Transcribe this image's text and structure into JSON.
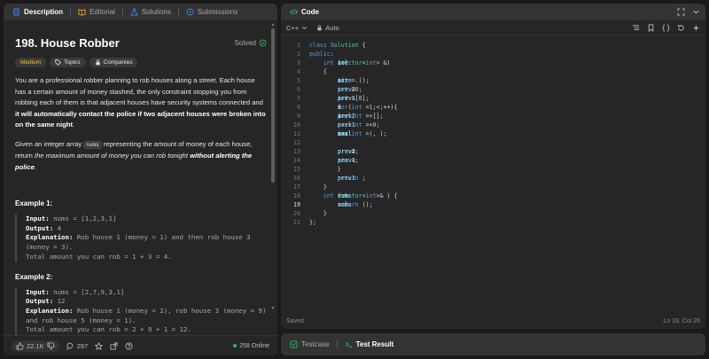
{
  "left_tabs": [
    {
      "label": "Description",
      "icon": "document-icon",
      "active": true
    },
    {
      "label": "Editorial",
      "icon": "book-icon",
      "active": false
    },
    {
      "label": "Solutions",
      "icon": "flask-icon",
      "active": false
    },
    {
      "label": "Submissions",
      "icon": "history-icon",
      "active": false
    }
  ],
  "problem": {
    "title": "198. House Robber",
    "status": "Solved",
    "badges": {
      "difficulty": "Medium",
      "topics": "Topics",
      "companies": "Companies"
    },
    "p1_a": "You are a professional robber planning to rob houses along a street. Each house has a certain amount of money stashed, the only constraint stopping you from robbing each of them is that adjacent houses have security systems connected and ",
    "p1_b": "it will automatically contact the police if two adjacent houses were broken into on the same night",
    "p1_c": ".",
    "p2_a": "Given an integer array ",
    "p2_code": "nums",
    "p2_b": " representing the amount of money of each house, return ",
    "p2_i": "the maximum amount of money you can rob tonight ",
    "p2_bi": "without alerting the police",
    "p2_c": ".",
    "examples": [
      {
        "title": "Example 1:",
        "input_label": "Input:",
        "input": " nums = [1,2,3,1]",
        "output_label": "Output:",
        "output": " 4",
        "expl_label": "Explanation:",
        "expl": " Rob house 1 (money = 1) and then rob house 3 (money = 3).",
        "total": "Total amount you can rob = 1 + 3 = 4."
      },
      {
        "title": "Example 2:",
        "input_label": "Input:",
        "input": " nums = [2,7,9,3,1]",
        "output_label": "Output:",
        "output": " 12",
        "expl_label": "Explanation:",
        "expl": " Rob house 1 (money = 2), rob house 3 (money = 9) and rob house 5 (money = 1).",
        "total": "Total amount you can rob = 2 + 9 + 1 = 12."
      }
    ]
  },
  "footer": {
    "likes": "22.1K",
    "comments": "297",
    "online": "258 Online"
  },
  "code_panel": {
    "title": "Code",
    "language": "C++",
    "mode": "Auto",
    "status": "Saved",
    "cursor": "Ln 19, Col 26",
    "current_line": 19,
    "lines": [
      [
        [
          "kw",
          "class "
        ],
        [
          "ty",
          "Solution"
        ],
        [
          "op",
          " {"
        ]
      ],
      [
        [
          "kw",
          "public"
        ],
        [
          "op",
          ":"
        ]
      ],
      [
        [
          "op",
          "    "
        ],
        [
          "kw",
          "int "
        ],
        [
          "lc",
          "sol"
        ],
        [
          "op",
          "("
        ],
        [
          "ty",
          "vector"
        ],
        [
          "op",
          "<"
        ],
        [
          "kw",
          "int"
        ],
        [
          "op",
          "> &"
        ],
        [
          "lc",
          "arr"
        ],
        [
          "op",
          ")"
        ]
      ],
      [
        [
          "op",
          "    {"
        ]
      ],
      [
        [
          "op",
          "        "
        ],
        [
          "kw",
          "int "
        ],
        [
          "lc",
          "n"
        ],
        [
          "op",
          "="
        ],
        [
          "lc",
          "arr"
        ],
        [
          "op",
          "."
        ],
        [
          "lc",
          "size"
        ],
        [
          "op",
          "();"
        ]
      ],
      [
        [
          "op",
          "        "
        ],
        [
          "kw",
          "int "
        ],
        [
          "lc",
          "prev2"
        ],
        [
          "op",
          "="
        ],
        [
          "nm",
          "0"
        ],
        [
          "op",
          ";"
        ]
      ],
      [
        [
          "op",
          "        "
        ],
        [
          "kw",
          "int "
        ],
        [
          "lc",
          "prev1"
        ],
        [
          "op",
          "="
        ],
        [
          "lc",
          "arr"
        ],
        [
          "op",
          "["
        ],
        [
          "nm",
          "0"
        ],
        [
          "op",
          "];"
        ]
      ],
      [
        [
          "op",
          "        "
        ],
        [
          "kw",
          "for"
        ],
        [
          "op",
          "("
        ],
        [
          "kw",
          "int "
        ],
        [
          "lc",
          "i"
        ],
        [
          "op",
          "="
        ],
        [
          "nm",
          "1"
        ],
        [
          "op",
          ";"
        ],
        [
          "lc",
          "i"
        ],
        [
          "op",
          "<"
        ],
        [
          "lc",
          "n"
        ],
        [
          "op",
          ";"
        ],
        [
          "lc",
          "i"
        ],
        [
          "op",
          "++){"
        ]
      ],
      [
        [
          "op",
          "            "
        ],
        [
          "kw",
          "int "
        ],
        [
          "lc",
          "incl"
        ],
        [
          "op",
          "="
        ],
        [
          "lc",
          "prev2"
        ],
        [
          "op",
          "+"
        ],
        [
          "lc",
          "arr"
        ],
        [
          "op",
          "["
        ],
        [
          "lc",
          "i"
        ],
        [
          "op",
          "];"
        ]
      ],
      [
        [
          "op",
          "            "
        ],
        [
          "kw",
          "int "
        ],
        [
          "lc",
          "excl"
        ],
        [
          "op",
          "="
        ],
        [
          "lc",
          "prev1"
        ],
        [
          "op",
          "+"
        ],
        [
          "nm",
          "0"
        ],
        [
          "op",
          ";"
        ]
      ],
      [
        [
          "op",
          "            "
        ],
        [
          "kw",
          "int "
        ],
        [
          "lc",
          "ans"
        ],
        [
          "op",
          "="
        ],
        [
          "lc",
          "max"
        ],
        [
          "op",
          "("
        ],
        [
          "lc",
          "incl"
        ],
        [
          "op",
          ", "
        ],
        [
          "lc",
          "excl"
        ],
        [
          "op",
          ");"
        ]
      ],
      [
        [
          "op",
          ""
        ]
      ],
      [
        [
          "op",
          "            "
        ],
        [
          "lc",
          "prev2"
        ],
        [
          "op",
          "="
        ],
        [
          "lc",
          "prev1"
        ],
        [
          "op",
          ";"
        ]
      ],
      [
        [
          "op",
          "            "
        ],
        [
          "lc",
          "prev1"
        ],
        [
          "op",
          "="
        ],
        [
          "lc",
          "ans"
        ],
        [
          "op",
          ";"
        ]
      ],
      [
        [
          "op",
          "        }"
        ]
      ],
      [
        [
          "op",
          "        "
        ],
        [
          "kw",
          "return "
        ],
        [
          "lc",
          "prev1"
        ],
        [
          "op",
          ";"
        ]
      ],
      [
        [
          "op",
          "    }"
        ]
      ],
      [
        [
          "op",
          "    "
        ],
        [
          "kw",
          "int "
        ],
        [
          "lc",
          "rob"
        ],
        [
          "op",
          "("
        ],
        [
          "ty",
          "vector"
        ],
        [
          "op",
          "<"
        ],
        [
          "kw",
          "int"
        ],
        [
          "op",
          ">& "
        ],
        [
          "lc",
          "nums"
        ],
        [
          "op",
          ") {"
        ]
      ],
      [
        [
          "op",
          "        "
        ],
        [
          "kw",
          "return "
        ],
        [
          "lc",
          "sol"
        ],
        [
          "op",
          "("
        ],
        [
          "lc",
          "nums"
        ],
        [
          "op",
          ");"
        ]
      ],
      [
        [
          "op",
          "    }"
        ]
      ],
      [
        [
          "op",
          "};"
        ]
      ]
    ]
  },
  "test_tabs": [
    {
      "label": "Testcase",
      "icon": "checkbox-icon",
      "active": false
    },
    {
      "label": "Test Result",
      "icon": "terminal-icon",
      "active": true
    }
  ]
}
